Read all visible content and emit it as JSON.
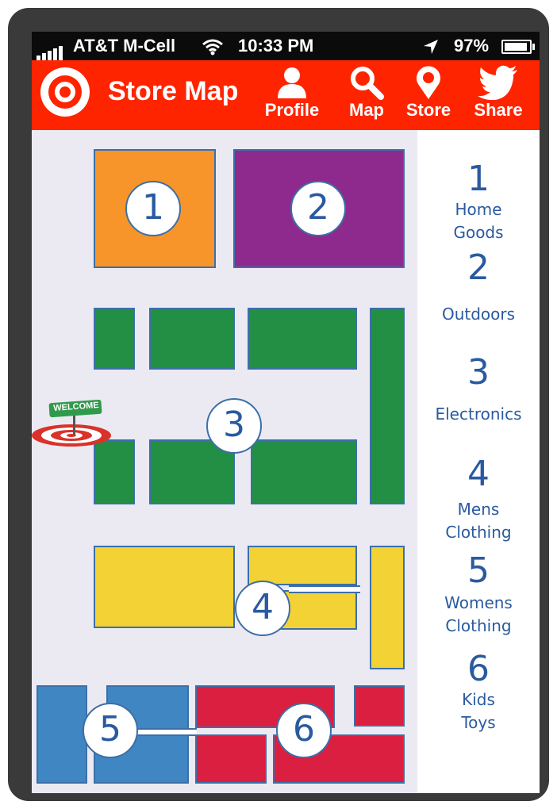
{
  "status_bar": {
    "carrier": "AT&T M-Cell",
    "time": "10:33 PM",
    "battery": "97%"
  },
  "nav": {
    "title": "Store Map",
    "buttons": [
      {
        "label": "Profile",
        "icon": "person-icon"
      },
      {
        "label": "Map",
        "icon": "magnifier-icon"
      },
      {
        "label": "Store",
        "icon": "map-pin-icon"
      },
      {
        "label": "Share",
        "icon": "twitter-bird-icon"
      }
    ]
  },
  "colors": {
    "brand_red": "#ff2400",
    "zone1": "#f7952b",
    "zone2": "#8e2a8e",
    "zone3": "#228f45",
    "zone4": "#f2d234",
    "zone5": "#3f86c2",
    "zone6": "#da1f41",
    "legend_text": "#2a5aa0"
  },
  "map": {
    "zones": [
      {
        "number": "1"
      },
      {
        "number": "2"
      },
      {
        "number": "3"
      },
      {
        "number": "4"
      },
      {
        "number": "5"
      },
      {
        "number": "6"
      }
    ],
    "entrance_sign": "WELCOME"
  },
  "legend": [
    {
      "number": "1",
      "label": "Home\nGoods"
    },
    {
      "number": "2",
      "label": "Outdoors"
    },
    {
      "number": "3",
      "label": "Electronics"
    },
    {
      "number": "4",
      "label": "Mens\nClothing"
    },
    {
      "number": "5",
      "label": "Womens\nClothing"
    },
    {
      "number": "6",
      "label": "Kids\nToys"
    }
  ]
}
